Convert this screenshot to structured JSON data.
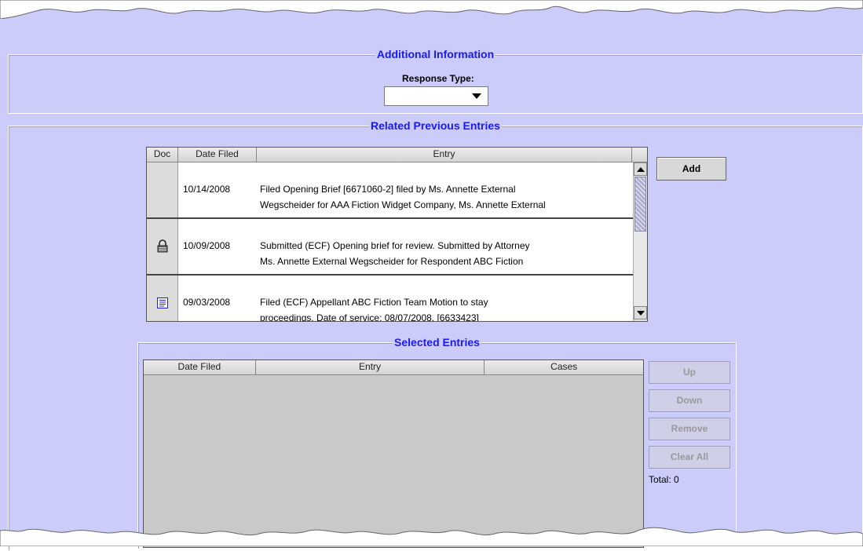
{
  "additional_info": {
    "title": "Additional Information",
    "response_type_label": "Response Type:",
    "response_type_value": ""
  },
  "related": {
    "title": "Related Previous Entries",
    "columns": [
      "Doc",
      "Date Filed",
      "Entry"
    ],
    "rows": [
      {
        "doc_icon": "none",
        "date": "10/14/2008",
        "entry_line1": "Filed Opening Brief [6671060-2] filed by Ms. Annette External",
        "entry_line2": "Wegscheider for AAA Fiction Widget Company, Ms. Annette External"
      },
      {
        "doc_icon": "lock-icon",
        "date": "10/09/2008",
        "entry_line1": "Submitted (ECF) Opening brief for review. Submitted by Attorney",
        "entry_line2": "Ms. Annette External Wegscheider for Respondent ABC Fiction"
      },
      {
        "doc_icon": "document-icon",
        "date": "09/03/2008",
        "entry_line1": "Filed (ECF) Appellant ABC Fiction Team Motion to stay",
        "entry_line2": "proceedings. Date of service: 08/07/2008. [6633423]"
      }
    ],
    "add_button": "Add"
  },
  "selected": {
    "title": "Selected Entries",
    "columns": [
      "Date Filed",
      "Entry",
      "Cases"
    ],
    "buttons": {
      "up": "Up",
      "down": "Down",
      "remove": "Remove",
      "clear_all": "Clear All"
    },
    "total_label": "Total: 0"
  },
  "colors": {
    "background": "#ccccfb",
    "title": "#1a1af0"
  }
}
